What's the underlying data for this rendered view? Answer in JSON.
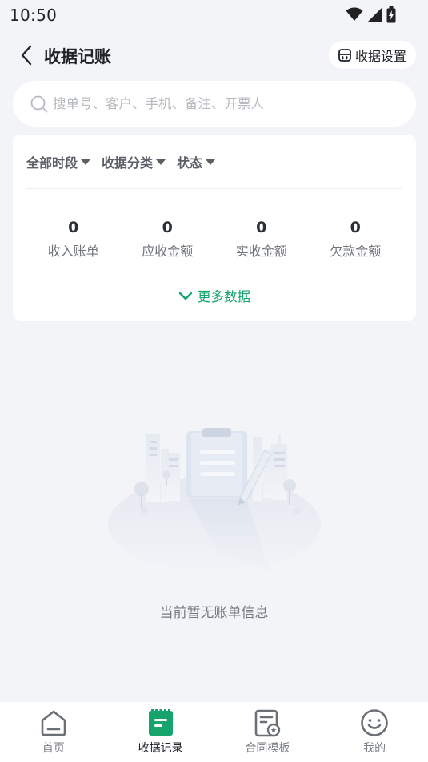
{
  "status_bar": {
    "time": "10:50"
  },
  "header": {
    "title": "收据记账",
    "settings_label": "收据设置"
  },
  "search": {
    "placeholder": "搜单号、客户、手机、备注、开票人",
    "value": ""
  },
  "filters": [
    {
      "label": "全部时段"
    },
    {
      "label": "收据分类"
    },
    {
      "label": "状态"
    }
  ],
  "stats": [
    {
      "value": "0",
      "label": "收入账单"
    },
    {
      "value": "0",
      "label": "应收金额"
    },
    {
      "value": "0",
      "label": "实收金额"
    },
    {
      "value": "0",
      "label": "欠款金额"
    }
  ],
  "more_data_label": "更多数据",
  "empty_state": {
    "message": "当前暂无账单信息"
  },
  "bottom_nav": [
    {
      "label": "首页",
      "icon": "home-icon",
      "active": false
    },
    {
      "label": "收据记录",
      "icon": "receipt-record-icon",
      "active": true
    },
    {
      "label": "合同模板",
      "icon": "contract-template-icon",
      "active": false
    },
    {
      "label": "我的",
      "icon": "profile-icon",
      "active": false
    }
  ],
  "colors": {
    "accent": "#15a46c",
    "background": "#f3f4f8",
    "icon_gray": "#6b6f76"
  }
}
